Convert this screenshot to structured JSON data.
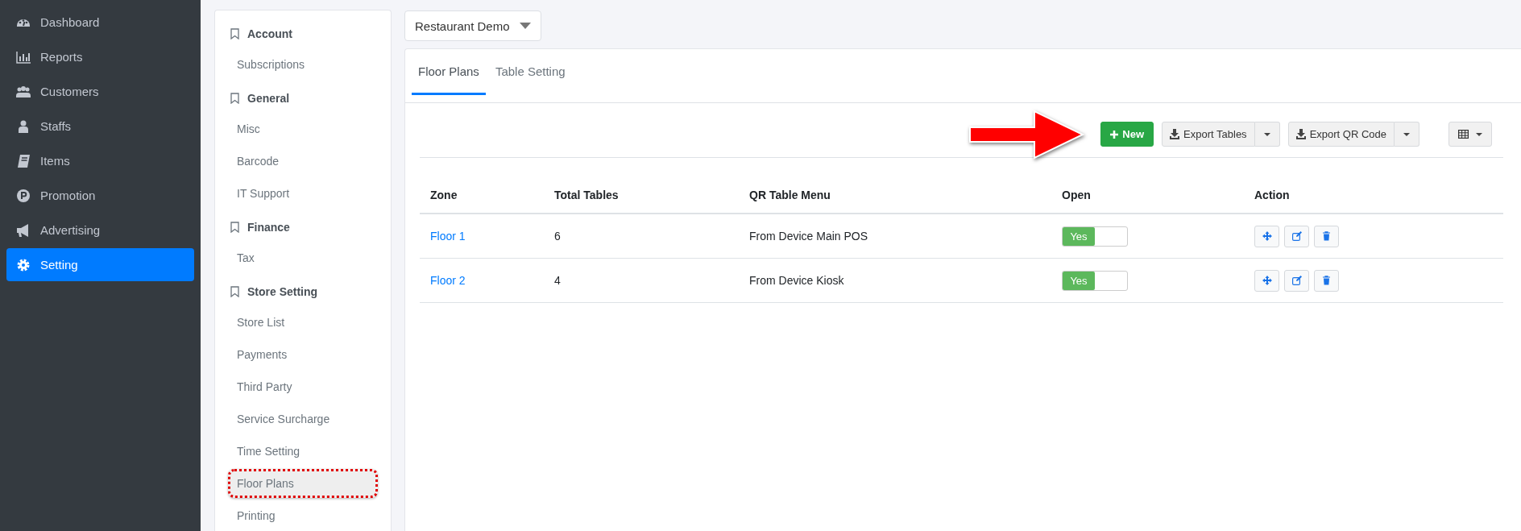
{
  "sidebar": {
    "items": [
      {
        "label": "Dashboard",
        "selected": false
      },
      {
        "label": "Reports",
        "selected": false
      },
      {
        "label": "Customers",
        "selected": false
      },
      {
        "label": "Staffs",
        "selected": false
      },
      {
        "label": "Items",
        "selected": false
      },
      {
        "label": "Promotion",
        "selected": false
      },
      {
        "label": "Advertising",
        "selected": false
      },
      {
        "label": "Setting",
        "selected": true
      }
    ]
  },
  "settings_menu": {
    "groups": [
      {
        "title": "Account",
        "items": [
          {
            "label": "Subscriptions",
            "selected": false
          }
        ]
      },
      {
        "title": "General",
        "items": [
          {
            "label": "Misc",
            "selected": false
          },
          {
            "label": "Barcode",
            "selected": false
          },
          {
            "label": "IT Support",
            "selected": false
          }
        ]
      },
      {
        "title": "Finance",
        "items": [
          {
            "label": "Tax",
            "selected": false
          }
        ]
      },
      {
        "title": "Store Setting",
        "items": [
          {
            "label": "Store List",
            "selected": false
          },
          {
            "label": "Payments",
            "selected": false
          },
          {
            "label": "Third Party",
            "selected": false
          },
          {
            "label": "Service Surcharge",
            "selected": false
          },
          {
            "label": "Time Setting",
            "selected": false
          },
          {
            "label": "Floor Plans",
            "selected": true
          },
          {
            "label": "Printing",
            "selected": false
          }
        ]
      }
    ]
  },
  "store_selector": {
    "value": "Restaurant Demo"
  },
  "tabs": [
    {
      "label": "Floor Plans",
      "selected": true
    },
    {
      "label": "Table Setting",
      "selected": false
    }
  ],
  "toolbar": {
    "buttons": [
      {
        "kind": "primary",
        "label": "New"
      },
      {
        "kind": "split",
        "label": "Export Tables"
      },
      {
        "kind": "split",
        "label": "Export QR Code"
      },
      {
        "kind": "columns"
      }
    ]
  },
  "table": {
    "columns": [
      "Zone",
      "Total Tables",
      "QR Table Menu",
      "Open",
      "Action"
    ],
    "rows": [
      {
        "zone": "Floor 1",
        "total_tables": "6",
        "qr_table_menu": "From Device Main POS",
        "open": {
          "label": "Yes",
          "on": true
        }
      },
      {
        "zone": "Floor 2",
        "total_tables": "4",
        "qr_table_menu": "From Device Kiosk",
        "open": {
          "label": "Yes",
          "on": true
        }
      }
    ]
  }
}
